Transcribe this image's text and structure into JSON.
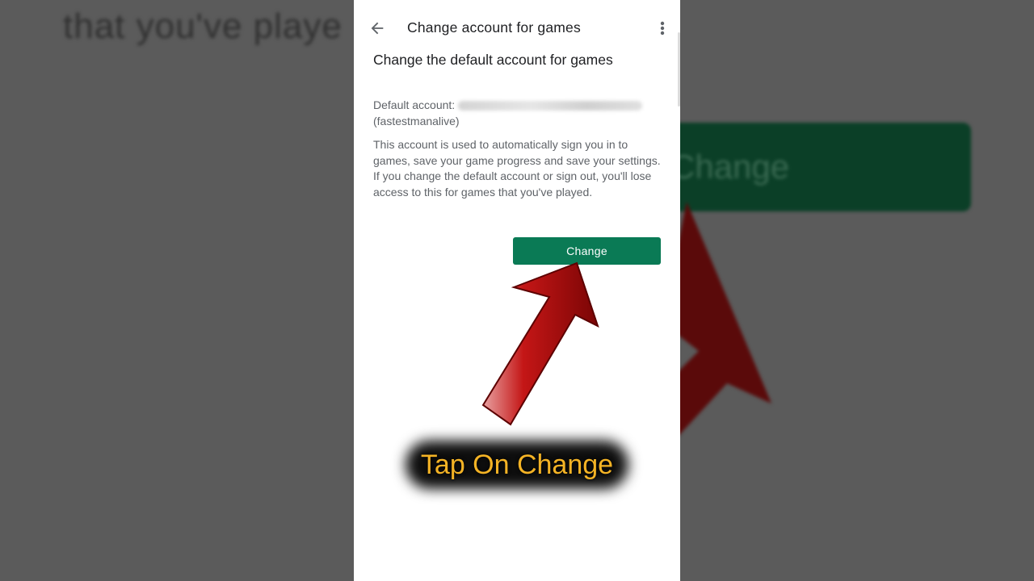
{
  "background": {
    "text": "that you've playe",
    "button_label": "Change"
  },
  "appbar": {
    "title": "Change account for games",
    "back_icon": "arrow-back-icon",
    "more_icon": "more-vert-icon"
  },
  "content": {
    "heading": "Change the default account for games",
    "default_account_label": "Default account:",
    "default_account_name": "(fastestmanalive)",
    "description": "This account is used to automatically sign you in to games, save your game progress and save your settings. If you change the default account or sign out, you'll lose access to this for games that you've played."
  },
  "change_button": {
    "label": "Change",
    "color": "#0a7a55"
  },
  "overlay": {
    "caption": "Tap On Change",
    "caption_color": "#f4b325",
    "arrow_icon": "red-arrow-icon",
    "arrow_color": "#b50f0f"
  }
}
